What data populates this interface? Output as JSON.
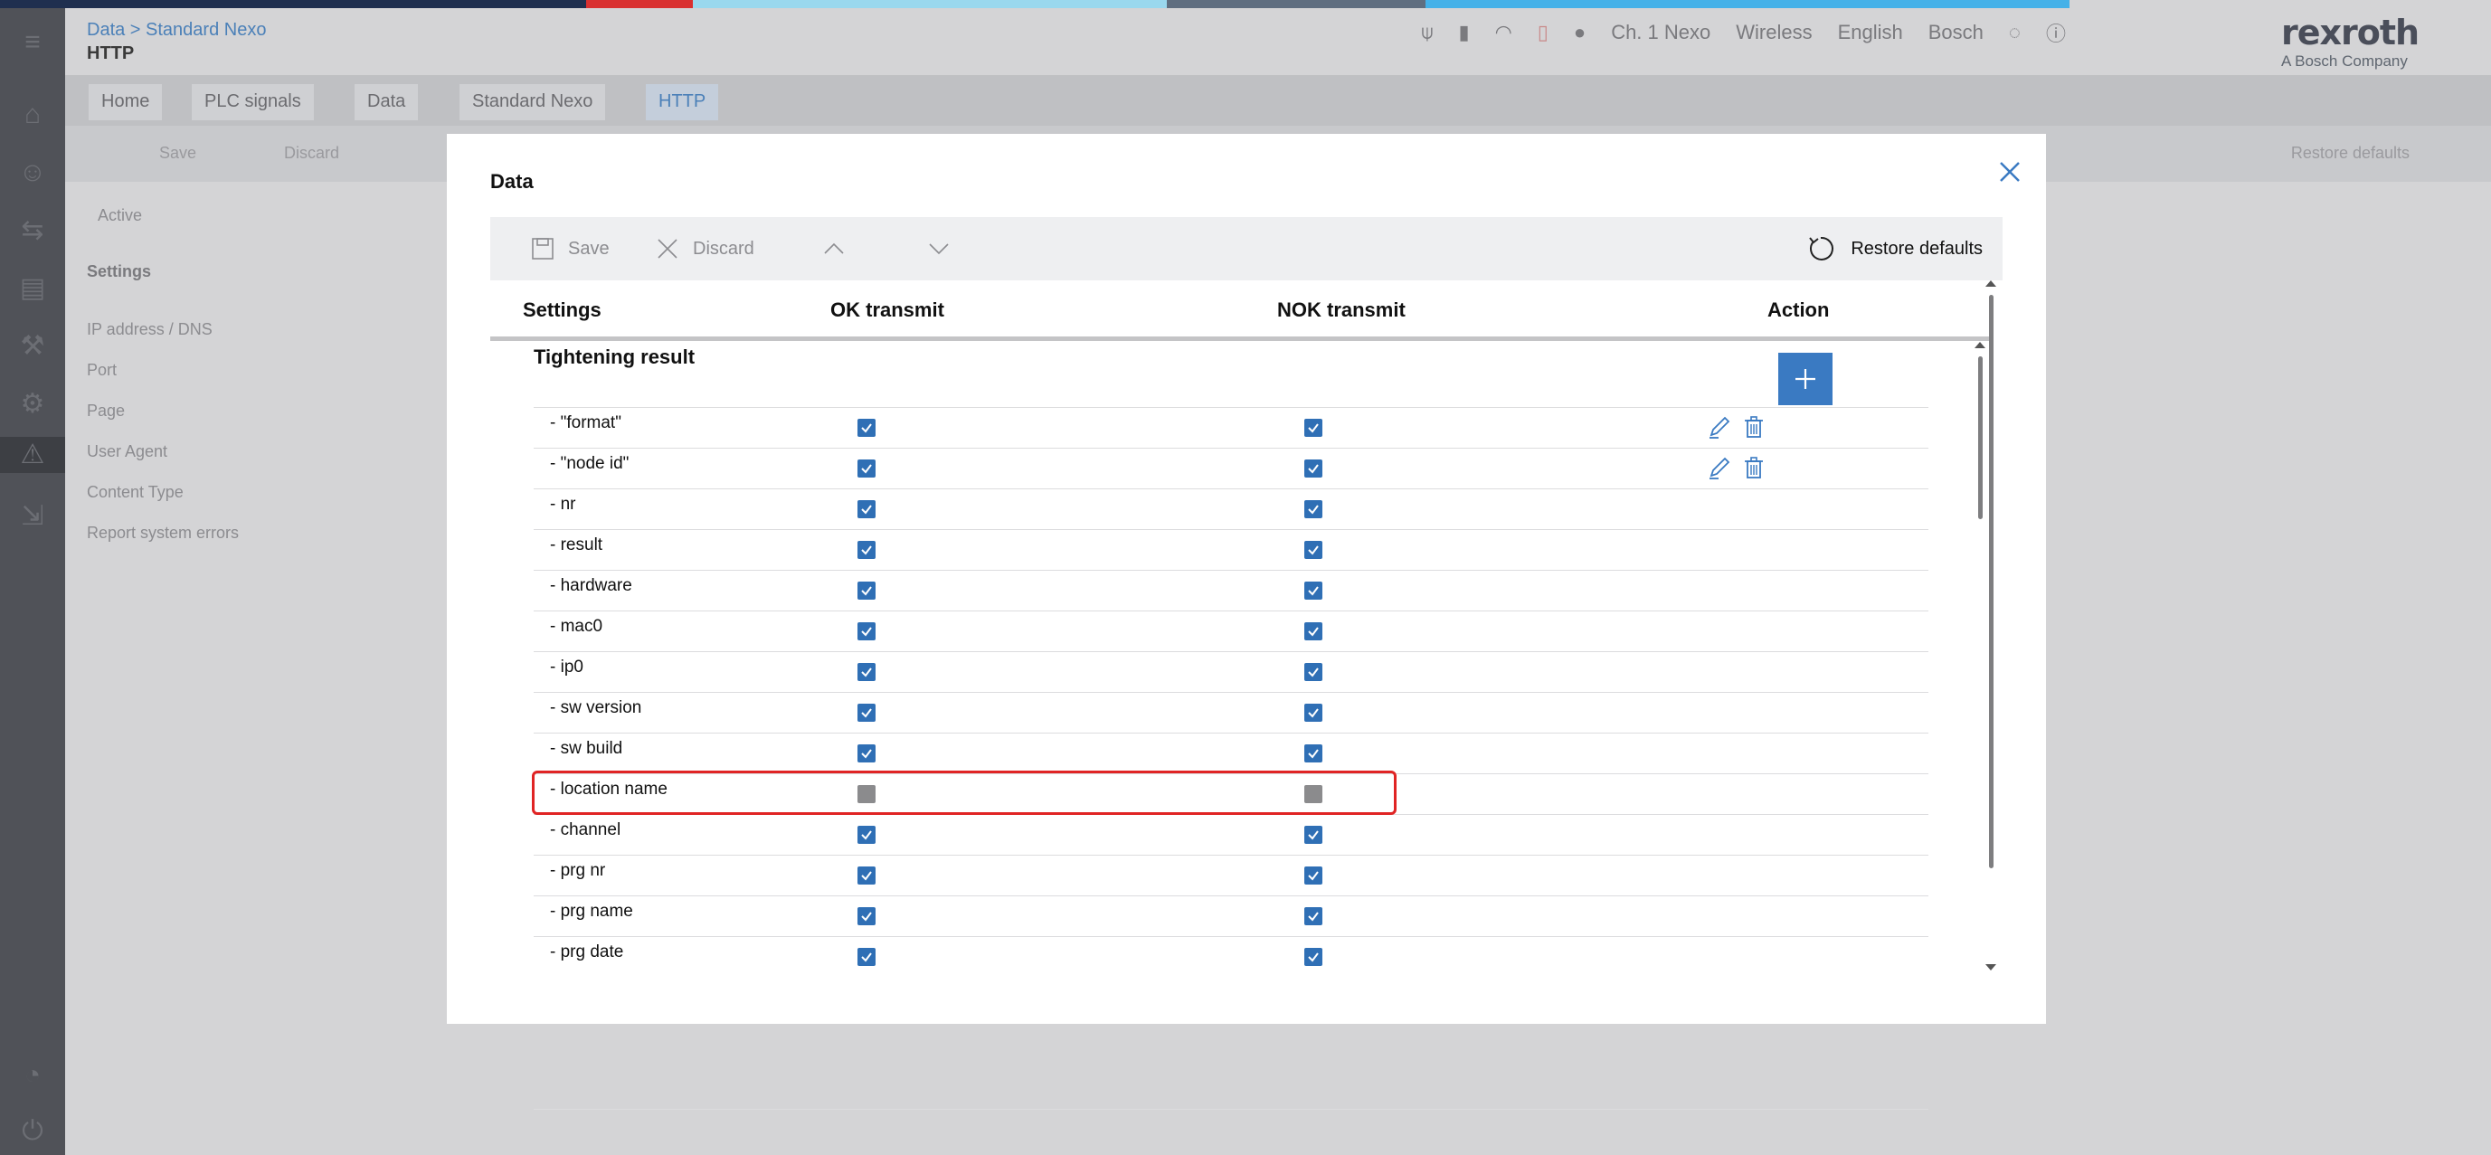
{
  "strip_colors": [
    "#1f2f4f",
    "#d93030",
    "#9ad8ee",
    "#5f6e80",
    "#45b1e8",
    "#d4d4d6"
  ],
  "background": {
    "breadcrumb": "Data > Standard Nexo",
    "title": "HTTP",
    "status": {
      "device": "Ch. 1 Nexo",
      "wireless": "Wireless",
      "language": "English",
      "user": "Bosch"
    },
    "logo": {
      "name": "rexroth",
      "sub": "A Bosch Company"
    },
    "tabs": [
      "Home",
      "PLC signals",
      "Data",
      "Standard Nexo",
      "HTTP"
    ],
    "toolbar": {
      "save": "Save",
      "discard": "Discard",
      "restore": "Restore defaults"
    },
    "active_label": "Active",
    "settings_label": "Settings",
    "rows": [
      "IP address / DNS",
      "Port",
      "Page",
      "User Agent",
      "Content Type",
      "Report system errors"
    ]
  },
  "dialog": {
    "title": "Data",
    "toolbar": {
      "save_label": "Save",
      "discard_label": "Discard",
      "restore_label": "Restore defaults"
    },
    "columns": {
      "settings": "Settings",
      "ok": "OK transmit",
      "nok": "NOK transmit",
      "action": "Action"
    },
    "group_title": "Tightening result",
    "rows": [
      {
        "label": "- \"format\"",
        "ok": true,
        "nok": true,
        "actions": true
      },
      {
        "label": "- \"node id\"",
        "ok": true,
        "nok": true,
        "actions": true
      },
      {
        "label": "- nr",
        "ok": true,
        "nok": true,
        "actions": false
      },
      {
        "label": "- result",
        "ok": true,
        "nok": true,
        "actions": false
      },
      {
        "label": "- hardware",
        "ok": true,
        "nok": true,
        "actions": false
      },
      {
        "label": "- mac0",
        "ok": true,
        "nok": true,
        "actions": false
      },
      {
        "label": "- ip0",
        "ok": true,
        "nok": true,
        "actions": false
      },
      {
        "label": "- sw version",
        "ok": true,
        "nok": true,
        "actions": false
      },
      {
        "label": "- sw build",
        "ok": true,
        "nok": true,
        "actions": false
      },
      {
        "label": "- location name",
        "ok": false,
        "nok": false,
        "actions": false
      },
      {
        "label": "- channel",
        "ok": true,
        "nok": true,
        "actions": false
      },
      {
        "label": "- prg nr",
        "ok": true,
        "nok": true,
        "actions": false
      },
      {
        "label": "- prg name",
        "ok": true,
        "nok": true,
        "actions": false
      },
      {
        "label": "- prg date",
        "ok": true,
        "nok": true,
        "actions": false
      }
    ],
    "colors": {
      "accent": "#3a7ac2",
      "checkbox": "#2f6fb5",
      "disabled": "#8b8b8d",
      "highlight": "#e02424"
    }
  }
}
